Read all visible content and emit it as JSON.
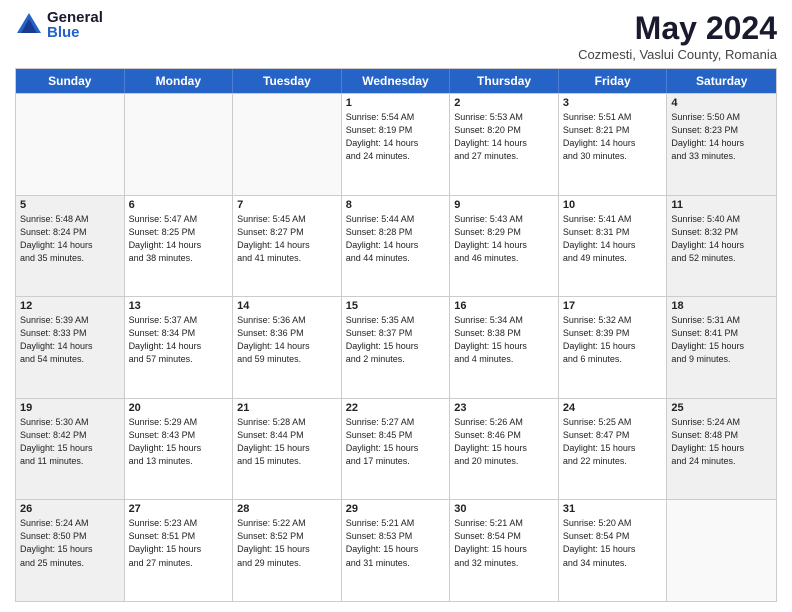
{
  "logo": {
    "general": "General",
    "blue": "Blue"
  },
  "title": {
    "month_year": "May 2024",
    "location": "Cozmesti, Vaslui County, Romania"
  },
  "days_of_week": [
    "Sunday",
    "Monday",
    "Tuesday",
    "Wednesday",
    "Thursday",
    "Friday",
    "Saturday"
  ],
  "weeks": [
    [
      {
        "day": "",
        "info": "",
        "empty": true
      },
      {
        "day": "",
        "info": "",
        "empty": true
      },
      {
        "day": "",
        "info": "",
        "empty": true
      },
      {
        "day": "1",
        "info": "Sunrise: 5:54 AM\nSunset: 8:19 PM\nDaylight: 14 hours\nand 24 minutes.",
        "empty": false
      },
      {
        "day": "2",
        "info": "Sunrise: 5:53 AM\nSunset: 8:20 PM\nDaylight: 14 hours\nand 27 minutes.",
        "empty": false
      },
      {
        "day": "3",
        "info": "Sunrise: 5:51 AM\nSunset: 8:21 PM\nDaylight: 14 hours\nand 30 minutes.",
        "empty": false
      },
      {
        "day": "4",
        "info": "Sunrise: 5:50 AM\nSunset: 8:23 PM\nDaylight: 14 hours\nand 33 minutes.",
        "empty": false,
        "shaded": true
      }
    ],
    [
      {
        "day": "5",
        "info": "Sunrise: 5:48 AM\nSunset: 8:24 PM\nDaylight: 14 hours\nand 35 minutes.",
        "empty": false,
        "shaded": true
      },
      {
        "day": "6",
        "info": "Sunrise: 5:47 AM\nSunset: 8:25 PM\nDaylight: 14 hours\nand 38 minutes.",
        "empty": false
      },
      {
        "day": "7",
        "info": "Sunrise: 5:45 AM\nSunset: 8:27 PM\nDaylight: 14 hours\nand 41 minutes.",
        "empty": false
      },
      {
        "day": "8",
        "info": "Sunrise: 5:44 AM\nSunset: 8:28 PM\nDaylight: 14 hours\nand 44 minutes.",
        "empty": false
      },
      {
        "day": "9",
        "info": "Sunrise: 5:43 AM\nSunset: 8:29 PM\nDaylight: 14 hours\nand 46 minutes.",
        "empty": false
      },
      {
        "day": "10",
        "info": "Sunrise: 5:41 AM\nSunset: 8:31 PM\nDaylight: 14 hours\nand 49 minutes.",
        "empty": false
      },
      {
        "day": "11",
        "info": "Sunrise: 5:40 AM\nSunset: 8:32 PM\nDaylight: 14 hours\nand 52 minutes.",
        "empty": false,
        "shaded": true
      }
    ],
    [
      {
        "day": "12",
        "info": "Sunrise: 5:39 AM\nSunset: 8:33 PM\nDaylight: 14 hours\nand 54 minutes.",
        "empty": false,
        "shaded": true
      },
      {
        "day": "13",
        "info": "Sunrise: 5:37 AM\nSunset: 8:34 PM\nDaylight: 14 hours\nand 57 minutes.",
        "empty": false
      },
      {
        "day": "14",
        "info": "Sunrise: 5:36 AM\nSunset: 8:36 PM\nDaylight: 14 hours\nand 59 minutes.",
        "empty": false
      },
      {
        "day": "15",
        "info": "Sunrise: 5:35 AM\nSunset: 8:37 PM\nDaylight: 15 hours\nand 2 minutes.",
        "empty": false
      },
      {
        "day": "16",
        "info": "Sunrise: 5:34 AM\nSunset: 8:38 PM\nDaylight: 15 hours\nand 4 minutes.",
        "empty": false
      },
      {
        "day": "17",
        "info": "Sunrise: 5:32 AM\nSunset: 8:39 PM\nDaylight: 15 hours\nand 6 minutes.",
        "empty": false
      },
      {
        "day": "18",
        "info": "Sunrise: 5:31 AM\nSunset: 8:41 PM\nDaylight: 15 hours\nand 9 minutes.",
        "empty": false,
        "shaded": true
      }
    ],
    [
      {
        "day": "19",
        "info": "Sunrise: 5:30 AM\nSunset: 8:42 PM\nDaylight: 15 hours\nand 11 minutes.",
        "empty": false,
        "shaded": true
      },
      {
        "day": "20",
        "info": "Sunrise: 5:29 AM\nSunset: 8:43 PM\nDaylight: 15 hours\nand 13 minutes.",
        "empty": false
      },
      {
        "day": "21",
        "info": "Sunrise: 5:28 AM\nSunset: 8:44 PM\nDaylight: 15 hours\nand 15 minutes.",
        "empty": false
      },
      {
        "day": "22",
        "info": "Sunrise: 5:27 AM\nSunset: 8:45 PM\nDaylight: 15 hours\nand 17 minutes.",
        "empty": false
      },
      {
        "day": "23",
        "info": "Sunrise: 5:26 AM\nSunset: 8:46 PM\nDaylight: 15 hours\nand 20 minutes.",
        "empty": false
      },
      {
        "day": "24",
        "info": "Sunrise: 5:25 AM\nSunset: 8:47 PM\nDaylight: 15 hours\nand 22 minutes.",
        "empty": false
      },
      {
        "day": "25",
        "info": "Sunrise: 5:24 AM\nSunset: 8:48 PM\nDaylight: 15 hours\nand 24 minutes.",
        "empty": false,
        "shaded": true
      }
    ],
    [
      {
        "day": "26",
        "info": "Sunrise: 5:24 AM\nSunset: 8:50 PM\nDaylight: 15 hours\nand 25 minutes.",
        "empty": false,
        "shaded": true
      },
      {
        "day": "27",
        "info": "Sunrise: 5:23 AM\nSunset: 8:51 PM\nDaylight: 15 hours\nand 27 minutes.",
        "empty": false
      },
      {
        "day": "28",
        "info": "Sunrise: 5:22 AM\nSunset: 8:52 PM\nDaylight: 15 hours\nand 29 minutes.",
        "empty": false
      },
      {
        "day": "29",
        "info": "Sunrise: 5:21 AM\nSunset: 8:53 PM\nDaylight: 15 hours\nand 31 minutes.",
        "empty": false
      },
      {
        "day": "30",
        "info": "Sunrise: 5:21 AM\nSunset: 8:54 PM\nDaylight: 15 hours\nand 32 minutes.",
        "empty": false
      },
      {
        "day": "31",
        "info": "Sunrise: 5:20 AM\nSunset: 8:54 PM\nDaylight: 15 hours\nand 34 minutes.",
        "empty": false
      },
      {
        "day": "",
        "info": "",
        "empty": true,
        "shaded": true
      }
    ]
  ]
}
